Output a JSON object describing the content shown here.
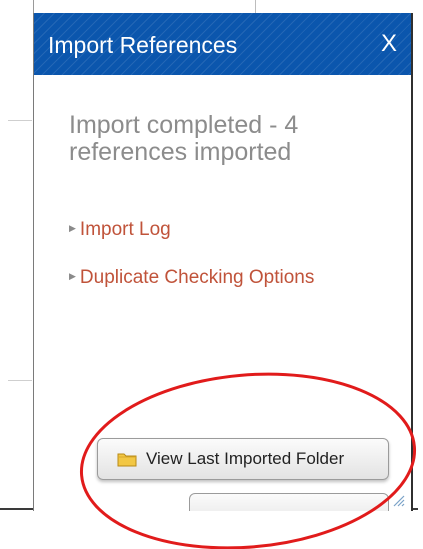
{
  "dialog": {
    "title": "Import References",
    "close_label": "X",
    "status_text": "Import completed - 4 references imported",
    "links": [
      {
        "label": "Import Log"
      },
      {
        "label": "Duplicate Checking Options"
      }
    ],
    "view_folder_button": {
      "label": "View Last Imported Folder",
      "icon": "folder-icon"
    }
  },
  "colors": {
    "titlebar": "#0b56ad",
    "link": "#c0533a",
    "status_text": "#8c8c8c",
    "annotation_circle": "#e11b1b"
  }
}
